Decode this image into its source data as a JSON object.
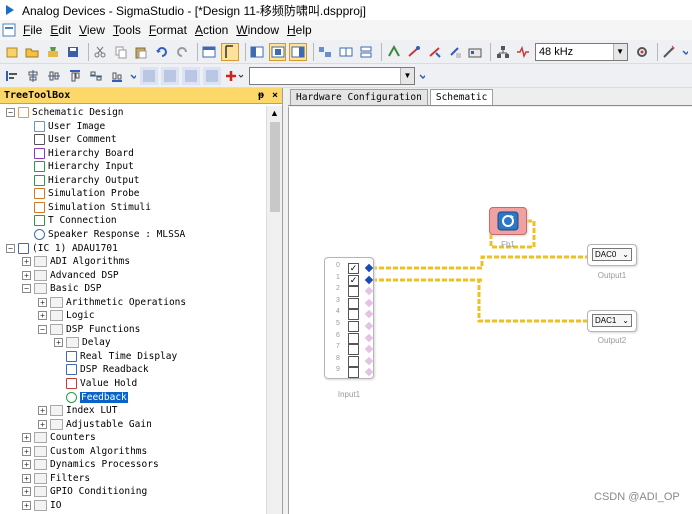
{
  "window": {
    "title": "Analog Devices - SigmaStudio - [*Design 11-移频防啸叫.dspproj]"
  },
  "menu": [
    {
      "accel": "F",
      "rest": "ile"
    },
    {
      "accel": "E",
      "rest": "dit"
    },
    {
      "accel": "V",
      "rest": "iew"
    },
    {
      "accel": "T",
      "rest": "ools"
    },
    {
      "accel": "F",
      "rest": "ormat"
    },
    {
      "accel": "A",
      "rest": "ction"
    },
    {
      "accel": "W",
      "rest": "indow"
    },
    {
      "accel": "H",
      "rest": "elp"
    }
  ],
  "toolbar": {
    "sample_rate": "48 kHz",
    "font_combo": ""
  },
  "toolbox": {
    "title": "TreeToolBox",
    "pin": "ᵽ",
    "close": "×",
    "items": [
      {
        "label": "Schematic Design",
        "indent": 0,
        "exp": "−",
        "icon": "schematic-design-icon"
      },
      {
        "label": "User Image",
        "indent": 1,
        "icon": "user-image-icon"
      },
      {
        "label": "User Comment",
        "indent": 1,
        "icon": "user-comment-icon"
      },
      {
        "label": "Hierarchy Board",
        "indent": 1,
        "icon": "hierarchy-board-icon"
      },
      {
        "label": "Hierarchy Input",
        "indent": 1,
        "icon": "hierarchy-input-icon"
      },
      {
        "label": "Hierarchy Output",
        "indent": 1,
        "icon": "hierarchy-output-icon"
      },
      {
        "label": "Simulation Probe",
        "indent": 1,
        "icon": "simulation-probe-icon"
      },
      {
        "label": "Simulation Stimuli",
        "indent": 1,
        "icon": "simulation-stimuli-icon"
      },
      {
        "label": "T Connection",
        "indent": 1,
        "icon": "t-connection-icon"
      },
      {
        "label": "Speaker Response : MLSSA",
        "indent": 1,
        "icon": "speaker-response-icon"
      },
      {
        "label": "(IC 1) ADAU1701",
        "indent": 0,
        "exp": "−",
        "icon": "ic-chip-icon"
      },
      {
        "label": "ADI Algorithms",
        "indent": 1,
        "exp": "+",
        "icon": "folder-icon"
      },
      {
        "label": "Advanced DSP",
        "indent": 1,
        "exp": "+",
        "icon": "folder-icon"
      },
      {
        "label": "Basic DSP",
        "indent": 1,
        "exp": "−",
        "icon": "folder-icon"
      },
      {
        "label": "Arithmetic Operations",
        "indent": 2,
        "exp": "+",
        "icon": "folder-icon"
      },
      {
        "label": "Logic",
        "indent": 2,
        "exp": "+",
        "icon": "folder-icon"
      },
      {
        "label": "DSP Functions",
        "indent": 2,
        "exp": "−",
        "icon": "folder-icon"
      },
      {
        "label": "Delay",
        "indent": 3,
        "exp": "+",
        "icon": "folder-icon"
      },
      {
        "label": "Real Time Display",
        "indent": 3,
        "icon": "real-time-display-icon"
      },
      {
        "label": "DSP Readback",
        "indent": 3,
        "icon": "dsp-readback-icon"
      },
      {
        "label": "Value Hold",
        "indent": 3,
        "icon": "value-hold-icon"
      },
      {
        "label": "Feedback",
        "indent": 3,
        "icon": "feedback-icon",
        "selected": true
      },
      {
        "label": "Index LUT",
        "indent": 2,
        "exp": "+",
        "icon": "folder-icon"
      },
      {
        "label": "Adjustable Gain",
        "indent": 2,
        "exp": "+",
        "icon": "folder-icon"
      },
      {
        "label": "Counters",
        "indent": 1,
        "exp": "+",
        "icon": "folder-icon"
      },
      {
        "label": "Custom Algorithms",
        "indent": 1,
        "exp": "+",
        "icon": "folder-icon"
      },
      {
        "label": "Dynamics Processors",
        "indent": 1,
        "exp": "+",
        "icon": "folder-icon"
      },
      {
        "label": "Filters",
        "indent": 1,
        "exp": "+",
        "icon": "folder-icon"
      },
      {
        "label": "GPIO Conditioning",
        "indent": 1,
        "exp": "+",
        "icon": "folder-icon"
      },
      {
        "label": "IO",
        "indent": 1,
        "exp": "+",
        "icon": "folder-icon"
      }
    ]
  },
  "tabs": [
    "Hardware Configuration",
    "Schematic"
  ],
  "canvas": {
    "input_label": "Input1",
    "input_pins": [
      "0",
      "1",
      "2",
      "3",
      "4",
      "5",
      "6",
      "7",
      "8",
      "9"
    ],
    "input_checked": [
      true,
      true,
      false,
      false,
      false,
      false,
      false,
      false,
      false,
      false
    ],
    "fb_label": "Fb1",
    "out1_value": "DAC0",
    "out1_label": "Output1",
    "out2_value": "DAC1",
    "out2_label": "Output2",
    "wire_color": "#f0c020"
  },
  "watermark": "CSDN @ADI_OP"
}
